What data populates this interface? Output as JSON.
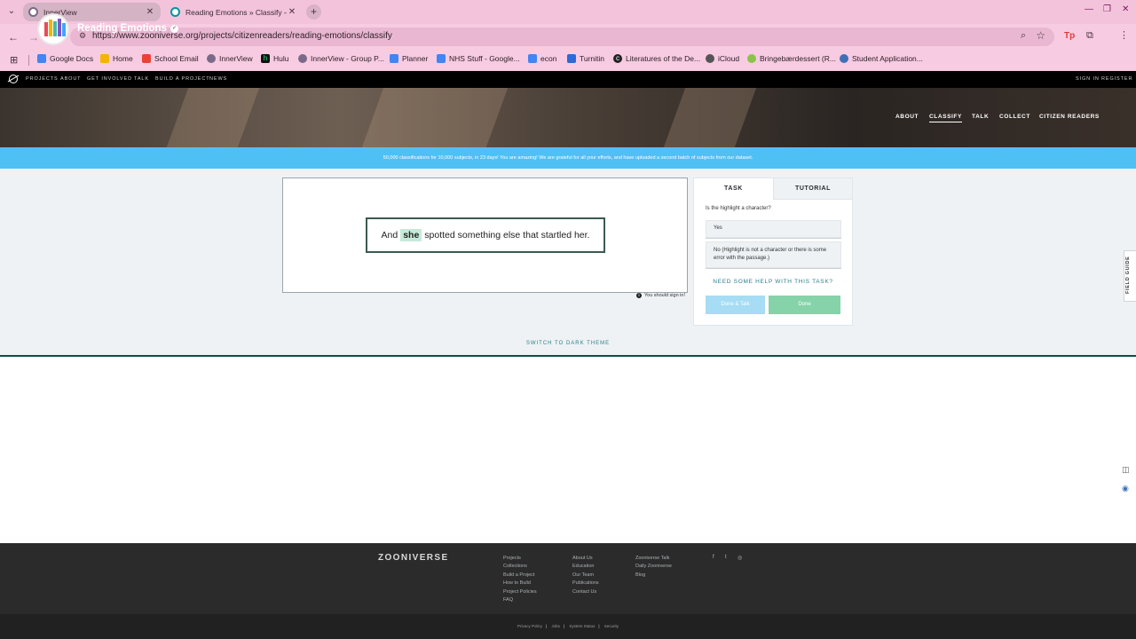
{
  "browser": {
    "tabs": [
      {
        "title": "InnerView",
        "active": false
      },
      {
        "title": "Reading Emotions » Classify —",
        "active": true
      }
    ],
    "url": "https://www.zooniverse.org/projects/citizenreaders/reading-emotions/classify",
    "bookmarks": [
      {
        "label": "Google Docs",
        "icon": "google-docs-icon",
        "color": "#4285f4"
      },
      {
        "label": "Home",
        "icon": "home-icon",
        "color": "#f4b400"
      },
      {
        "label": "School Email",
        "icon": "gmail-icon",
        "color": "#ea4335"
      },
      {
        "label": "InnerView",
        "icon": "innerview-icon",
        "color": "#7a6a88"
      },
      {
        "label": "Hulu",
        "icon": "hulu-icon",
        "color": "#1ce783"
      },
      {
        "label": "InnerView - Group P...",
        "icon": "innerview-icon",
        "color": "#7a6a88"
      },
      {
        "label": "Planner",
        "icon": "planner-icon",
        "color": "#4285f4"
      },
      {
        "label": "NHS Stuff - Google...",
        "icon": "google-docs-icon",
        "color": "#4285f4"
      },
      {
        "label": "econ",
        "icon": "google-docs-icon",
        "color": "#4285f4"
      },
      {
        "label": "Turnitin",
        "icon": "turnitin-icon",
        "color": "#2d6ad8"
      },
      {
        "label": "Literatures of the De...",
        "icon": "circle-c-icon",
        "color": "#222222"
      },
      {
        "label": "iCloud",
        "icon": "apple-icon",
        "color": "#555555"
      },
      {
        "label": "Bringebærdessert (R...",
        "icon": "recipe-icon",
        "color": "#8bc34a"
      },
      {
        "label": "Student Application...",
        "icon": "student-icon",
        "color": "#3f6fb5"
      }
    ]
  },
  "zooniverse_nav": {
    "links": [
      "PROJECTS",
      "ABOUT",
      "GET INVOLVED",
      "TALK",
      "BUILD A PROJECT",
      "NEWS"
    ],
    "auth": [
      "SIGN IN",
      "REGISTER"
    ]
  },
  "project": {
    "title": "Reading Emotions",
    "nav": [
      "ABOUT",
      "CLASSIFY",
      "TALK",
      "COLLECT",
      "CITIZEN READERS"
    ],
    "active_nav": "CLASSIFY"
  },
  "announcement": "50,000 classifications for 10,000 subjects, in 23 days! You are amazing! We are grateful for all your efforts, and have uploaded a second batch of subjects from our dataset.",
  "subject": {
    "before": "And",
    "highlight": "she",
    "after": "spotted something else that startled her."
  },
  "signin_note": "You should sign in!",
  "task": {
    "tabs": [
      "TASK",
      "TUTORIAL"
    ],
    "question": "Is the highlight a character?",
    "answers": [
      "Yes",
      "No (Highlight is not a character or there is some error with the passage.)"
    ],
    "help": "NEED SOME HELP WITH THIS TASK?",
    "done_talk": "Done & Talk",
    "done": "Done"
  },
  "dark_theme": "SWITCH TO DARK THEME",
  "field_guide": "FIELD GUIDE",
  "footer": {
    "logo": "ZOONIVERSE",
    "col1": [
      "Projects",
      "Collections",
      "Build a Project",
      "How to Build",
      "Project Policies",
      "FAQ"
    ],
    "col2": [
      "About Us",
      "Education",
      "Our Team",
      "Publications",
      "Contact Us"
    ],
    "col3": [
      "Zooniverse Talk",
      "Daily Zooniverse",
      "Blog"
    ],
    "social": [
      "f",
      "t",
      "◎"
    ],
    "legal": [
      "Privacy Policy",
      "Jobs",
      "System Status",
      "Security"
    ]
  },
  "colors": {
    "chrome_pink": "#f3c3dc",
    "announcement_blue": "#4fc0f4",
    "teal_link": "#2b7f8a",
    "done_green": "#86d2a9",
    "done_talk_blue": "#a6dcf4"
  }
}
